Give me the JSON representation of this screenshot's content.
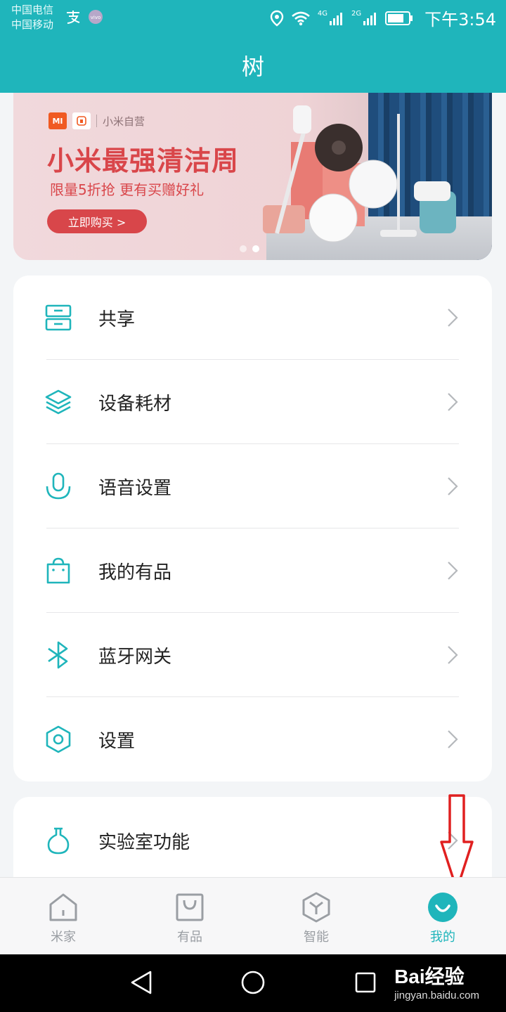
{
  "status_bar": {
    "carrier1": "中国电信",
    "carrier2": "中国移动",
    "net1": "4G",
    "net2": "2G",
    "time": "下午3:54"
  },
  "header": {
    "title": "树"
  },
  "banner": {
    "brand_mi": "MI",
    "brand_name": "小米自营",
    "title": "小米最强清洁周",
    "subtitle": "限量5折抢 更有买赠好礼",
    "button_label": "立即购买 >",
    "slide_count": 2,
    "active_slide": 2
  },
  "menu": {
    "items": [
      {
        "label": "共享",
        "icon": "share-icon"
      },
      {
        "label": "设备耗材",
        "icon": "layers-icon"
      },
      {
        "label": "语音设置",
        "icon": "microphone-icon"
      },
      {
        "label": "我的有品",
        "icon": "shopping-bag-icon"
      },
      {
        "label": "蓝牙网关",
        "icon": "bluetooth-icon"
      },
      {
        "label": "设置",
        "icon": "hexagon-gear-icon"
      }
    ],
    "lab": {
      "label": "实验室功能",
      "icon": "flask-icon"
    }
  },
  "tabs": [
    {
      "label": "米家",
      "icon": "home-icon",
      "active": false
    },
    {
      "label": "有品",
      "icon": "bag-icon",
      "active": false
    },
    {
      "label": "智能",
      "icon": "smart-hexagon-icon",
      "active": false
    },
    {
      "label": "我的",
      "icon": "profile-smile-icon",
      "active": true
    }
  ],
  "watermark": {
    "main": "Bai经验",
    "sub": "jingyan.baidu.com"
  },
  "colors": {
    "accent": "#1fb5bb",
    "banner_red": "#d9464a",
    "annotation": "#e02020"
  }
}
